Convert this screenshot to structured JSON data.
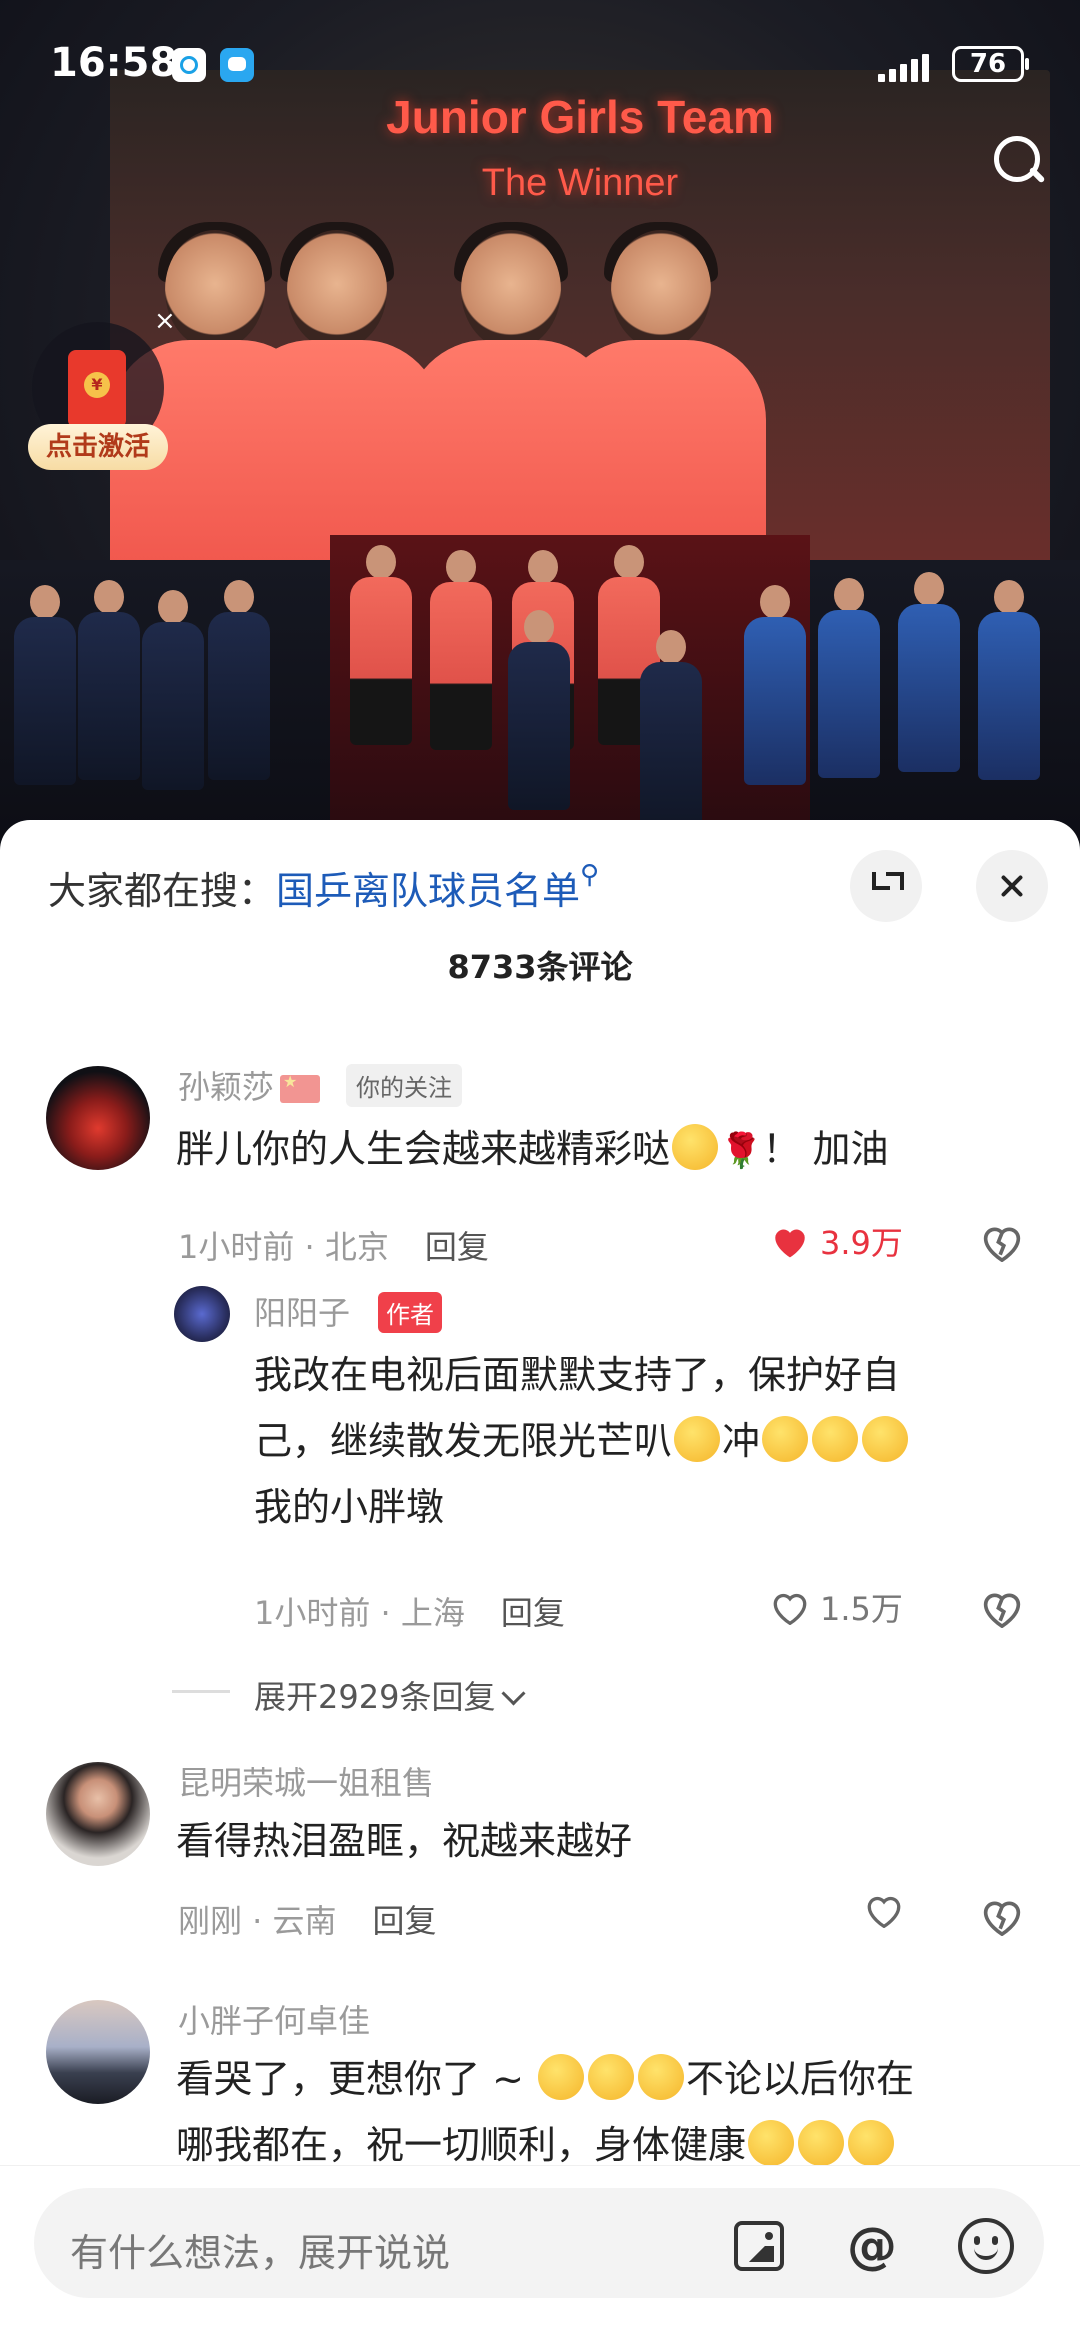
{
  "status_bar": {
    "time": "16:58",
    "battery": "76"
  },
  "video": {
    "screen_title": "Junior Girls Team",
    "screen_subtitle": "The Winner",
    "red_packet_label": "点击激活",
    "red_packet_close": "×"
  },
  "sheet": {
    "hot_search_prefix": "大家都在搜：",
    "hot_search_keyword": "国乒离队球员名单",
    "comment_count": "8733条评论"
  },
  "comments": [
    {
      "username": "孙颖莎",
      "badge": "你的关注",
      "text": "胖儿你的人生会越来越精彩哒",
      "text_tail": "！ 加油",
      "time_location": "1小时前 · 北京",
      "reply_label": "回复",
      "likes": "3.9万",
      "liked": true
    },
    {
      "username": "阳阳子",
      "badge": "作者",
      "text_line1": "我改在电视后面默默支持了，保护好自",
      "text_line2a": "己，继续散发无限光芒叭",
      "text_line2b": "冲",
      "text_line3": "我的小胖墩",
      "time_location": "1小时前 · 上海",
      "reply_label": "回复",
      "likes": "1.5万",
      "liked": false,
      "expand_label": "展开2929条回复"
    },
    {
      "username": "昆明荣城一姐租售",
      "text": "看得热泪盈眶，祝越来越好",
      "time_location": "刚刚 · 云南",
      "reply_label": "回复"
    },
    {
      "username": "小胖子何卓佳",
      "text_line1a": "看哭了，更想你了 ~ ",
      "text_line1b": "不论以后你在",
      "text_line2": "哪我都在，祝一切顺利，身体健康"
    }
  ],
  "input_bar": {
    "placeholder": "有什么想法，展开说说",
    "at_symbol": "@"
  },
  "colors": {
    "accent_blue": "#1d5bb8",
    "like_red": "#e8323f",
    "author_badge": "#f0404a"
  }
}
